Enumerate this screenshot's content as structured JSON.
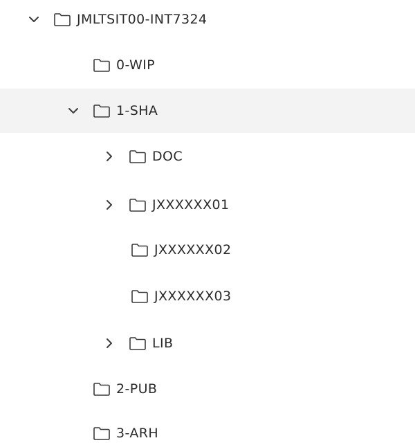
{
  "tree": {
    "nodes": [
      {
        "label": "JMLTSIT00-INT7324",
        "chevron": "chevron-down-icon",
        "selected": false
      },
      {
        "label": "0-WIP",
        "chevron": "",
        "selected": false
      },
      {
        "label": "1-SHA",
        "chevron": "chevron-down-icon",
        "selected": true
      },
      {
        "label": "DOC",
        "chevron": "chevron-right-icon",
        "selected": false
      },
      {
        "label": "JXXXXXX01",
        "chevron": "chevron-right-icon",
        "selected": false
      },
      {
        "label": "JXXXXXX02",
        "chevron": "",
        "selected": false
      },
      {
        "label": "JXXXXXX03",
        "chevron": "",
        "selected": false
      },
      {
        "label": "LIB",
        "chevron": "chevron-right-icon",
        "selected": false
      },
      {
        "label": "2-PUB",
        "chevron": "",
        "selected": false
      },
      {
        "label": "3-ARH",
        "chevron": "",
        "selected": false
      }
    ]
  },
  "colors": {
    "text": "#2b2b2b",
    "icon": "#3a3a3a",
    "selected_row": "#f3f3f3"
  }
}
